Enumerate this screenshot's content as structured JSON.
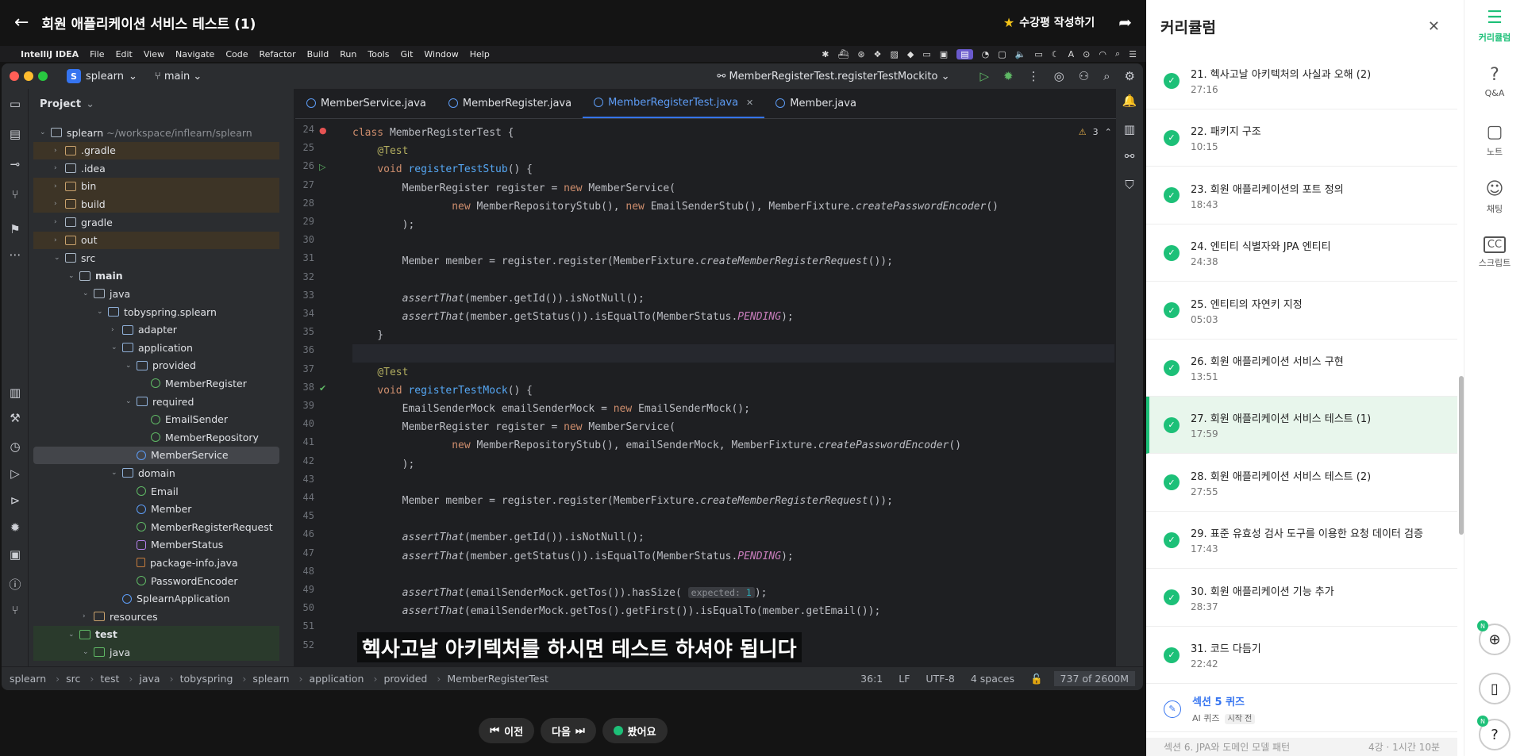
{
  "player": {
    "title": "회원 애플리케이션 서비스 테스트 (1)",
    "review_label": "수강평 작성하기",
    "subtitle": "헥사고날 아키텍처를 하시면 테스트 하셔야 됩니다",
    "controls": {
      "prev": "이전",
      "next": "다음",
      "done": "봤어요"
    }
  },
  "menubar": {
    "app_name": "IntelliJ IDEA",
    "items": [
      "File",
      "Edit",
      "View",
      "Navigate",
      "Code",
      "Refactor",
      "Build",
      "Run",
      "Tools",
      "Git",
      "Window",
      "Help"
    ]
  },
  "ide": {
    "project_badge": "S",
    "project_name": "splearn",
    "branch": "main",
    "run_config": "MemberRegisterTest.registerTestMockito",
    "panel_title": "Project",
    "tree": [
      {
        "label": "splearn",
        "path": "~/workspace/inflearn/splearn",
        "depth": 0,
        "open": true,
        "icon": "folder"
      },
      {
        "label": ".gradle",
        "depth": 1,
        "open": false,
        "icon": "folder-o",
        "tone": "orange"
      },
      {
        "label": ".idea",
        "depth": 1,
        "open": false,
        "icon": "folder"
      },
      {
        "label": "bin",
        "depth": 1,
        "open": false,
        "icon": "folder-o",
        "tone": "orange"
      },
      {
        "label": "build",
        "depth": 1,
        "open": false,
        "icon": "folder-o",
        "tone": "orange"
      },
      {
        "label": "gradle",
        "depth": 1,
        "open": false,
        "icon": "folder"
      },
      {
        "label": "out",
        "depth": 1,
        "open": false,
        "icon": "folder-o",
        "tone": "orange"
      },
      {
        "label": "src",
        "depth": 1,
        "open": true,
        "icon": "folder"
      },
      {
        "label": "main",
        "depth": 2,
        "open": true,
        "icon": "folder",
        "bold": true
      },
      {
        "label": "java",
        "depth": 3,
        "open": true,
        "icon": "folder"
      },
      {
        "label": "tobyspring.splearn",
        "depth": 4,
        "open": true,
        "icon": "pkg"
      },
      {
        "label": "adapter",
        "depth": 5,
        "open": false,
        "icon": "pkg"
      },
      {
        "label": "application",
        "depth": 5,
        "open": true,
        "icon": "pkg"
      },
      {
        "label": "provided",
        "depth": 6,
        "open": true,
        "icon": "pkg"
      },
      {
        "label": "MemberRegister",
        "depth": 7,
        "icon": "iface"
      },
      {
        "label": "required",
        "depth": 6,
        "open": true,
        "icon": "pkg"
      },
      {
        "label": "EmailSender",
        "depth": 7,
        "icon": "iface"
      },
      {
        "label": "MemberRepository",
        "depth": 7,
        "icon": "iface"
      },
      {
        "label": "MemberService",
        "depth": 6,
        "icon": "cls",
        "selected": true
      },
      {
        "label": "domain",
        "depth": 5,
        "open": true,
        "icon": "pkg"
      },
      {
        "label": "Email",
        "depth": 6,
        "icon": "iface"
      },
      {
        "label": "Member",
        "depth": 6,
        "icon": "cls"
      },
      {
        "label": "MemberRegisterRequest",
        "depth": 6,
        "icon": "iface"
      },
      {
        "label": "MemberStatus",
        "depth": 6,
        "icon": "enum"
      },
      {
        "label": "package-info.java",
        "depth": 6,
        "icon": "file"
      },
      {
        "label": "PasswordEncoder",
        "depth": 6,
        "icon": "iface"
      },
      {
        "label": "SplearnApplication",
        "depth": 5,
        "icon": "app"
      },
      {
        "label": "resources",
        "depth": 3,
        "open": false,
        "icon": "res"
      },
      {
        "label": "test",
        "depth": 2,
        "open": true,
        "icon": "test",
        "bold": true,
        "tone": "green"
      },
      {
        "label": "java",
        "depth": 3,
        "open": true,
        "icon": "test",
        "tone": "green"
      }
    ],
    "tabs": [
      {
        "label": "MemberService.java",
        "active": false
      },
      {
        "label": "MemberRegister.java",
        "active": false
      },
      {
        "label": "MemberRegisterTest.java",
        "active": true
      },
      {
        "label": "Member.java",
        "active": false
      }
    ],
    "warnings": "3",
    "code": [
      {
        "n": "24",
        "html": "<span class=\"kw\">class</span> MemberRegisterTest {"
      },
      {
        "n": "25",
        "html": "    <span class=\"ann\">@Test</span>"
      },
      {
        "n": "26",
        "html": "    <span class=\"kw\">void</span> <span class=\"mth\">registerTestStub</span>() {"
      },
      {
        "n": "27",
        "html": "        MemberRegister register = <span class=\"kw\">new</span> MemberService("
      },
      {
        "n": "28",
        "html": "                <span class=\"kw\">new</span> MemberRepositoryStub(), <span class=\"kw\">new</span> EmailSenderStub(), MemberFixture.<span class=\"it\">createPasswordEncoder</span>()"
      },
      {
        "n": "29",
        "html": "        );"
      },
      {
        "n": "30",
        "html": ""
      },
      {
        "n": "31",
        "html": "        Member member = register.register(MemberFixture.<span class=\"it\">createMemberRegisterRequest</span>());"
      },
      {
        "n": "32",
        "html": ""
      },
      {
        "n": "33",
        "html": "        <span class=\"it\">assertThat</span>(member.getId()).isNotNull();"
      },
      {
        "n": "34",
        "html": "        <span class=\"it\">assertThat</span>(member.getStatus()).isEqualTo(MemberStatus.<span class=\"cst\">PENDING</span>);"
      },
      {
        "n": "35",
        "html": "    }"
      },
      {
        "n": "36",
        "html": "",
        "current": true
      },
      {
        "n": "37",
        "html": "    <span class=\"ann\">@Test</span>"
      },
      {
        "n": "38",
        "html": "    <span class=\"kw\">void</span> <span class=\"mth\">registerTestMock</span>() {"
      },
      {
        "n": "39",
        "html": "        EmailSenderMock emailSenderMock = <span class=\"kw\">new</span> EmailSenderMock();"
      },
      {
        "n": "40",
        "html": "        MemberRegister register = <span class=\"kw\">new</span> MemberService("
      },
      {
        "n": "41",
        "html": "                <span class=\"kw\">new</span> MemberRepositoryStub(), emailSenderMock, MemberFixture.<span class=\"it\">createPasswordEncoder</span>()"
      },
      {
        "n": "42",
        "html": "        );"
      },
      {
        "n": "43",
        "html": ""
      },
      {
        "n": "44",
        "html": "        Member member = register.register(MemberFixture.<span class=\"it\">createMemberRegisterRequest</span>());"
      },
      {
        "n": "45",
        "html": ""
      },
      {
        "n": "46",
        "html": "        <span class=\"it\">assertThat</span>(member.getId()).isNotNull();"
      },
      {
        "n": "47",
        "html": "        <span class=\"it\">assertThat</span>(member.getStatus()).isEqualTo(MemberStatus.<span class=\"cst\">PENDING</span>);"
      },
      {
        "n": "48",
        "html": ""
      },
      {
        "n": "49",
        "html": "        <span class=\"it\">assertThat</span>(emailSenderMock.getTos()).hasSize( <span class=\"hint\">expected: <span class=\"num\">1</span></span>);"
      },
      {
        "n": "50",
        "html": "        <span class=\"it\">assertThat</span>(emailSenderMock.getTos().getFirst()).isEqualTo(member.getEmail());"
      },
      {
        "n": "51",
        "html": ""
      },
      {
        "n": "52",
        "html": ""
      }
    ],
    "breadcrumbs": [
      "splearn",
      "src",
      "test",
      "java",
      "tobyspring",
      "splearn",
      "application",
      "provided",
      "MemberRegisterTest"
    ],
    "status": {
      "pos": "36:1",
      "eol": "LF",
      "enc": "UTF-8",
      "indent": "4 spaces",
      "mem": "737 of 2600M"
    }
  },
  "curriculum": {
    "title": "커리큘럼",
    "lectures": [
      {
        "name": "21. 헥사고날 아키텍처의 사실과 오해 (2)",
        "dur": "27:16"
      },
      {
        "name": "22. 패키지 구조",
        "dur": "10:15"
      },
      {
        "name": "23. 회원 애플리케이션의 포트 정의",
        "dur": "18:43"
      },
      {
        "name": "24. 엔티티 식별자와 JPA 엔티티",
        "dur": "24:38"
      },
      {
        "name": "25. 엔티티의 자연키 지정",
        "dur": "05:03"
      },
      {
        "name": "26. 회원 애플리케이션 서비스 구현",
        "dur": "13:51"
      },
      {
        "name": "27. 회원 애플리케이션 서비스 테스트 (1)",
        "dur": "17:59",
        "active": true
      },
      {
        "name": "28. 회원 애플리케이션 서비스 테스트 (2)",
        "dur": "27:55"
      },
      {
        "name": "29. 표준 유효성 검사 도구를 이용한 요청 데이터 검증",
        "dur": "17:43"
      },
      {
        "name": "30. 회원 애플리케이션 기능 추가",
        "dur": "28:37"
      },
      {
        "name": "31. 코드 다듬기",
        "dur": "22:42"
      }
    ],
    "quiz": {
      "title": "섹션 5 퀴즈",
      "type": "AI 퀴즈",
      "badge": "시작 전"
    },
    "next_section": {
      "title": "섹션 6. JPA와 도메인 모델 패턴",
      "meta": "4강 · 1시간 10분"
    }
  },
  "rail": {
    "items": [
      {
        "label": "커리큘럼",
        "icon": "list-check-icon",
        "glyph": "☰",
        "active": true
      },
      {
        "label": "Q&A",
        "icon": "question-bubble-icon",
        "glyph": "?"
      },
      {
        "label": "노트",
        "icon": "note-icon",
        "glyph": "▢"
      },
      {
        "label": "채팅",
        "icon": "chat-smile-icon",
        "glyph": "☺"
      },
      {
        "label": "스크립트",
        "icon": "cc-icon",
        "glyph": "CC"
      }
    ]
  },
  "colors": {
    "accent": "#1dc078",
    "ide_bg": "#1e1f22",
    "link": "#3574f0"
  }
}
